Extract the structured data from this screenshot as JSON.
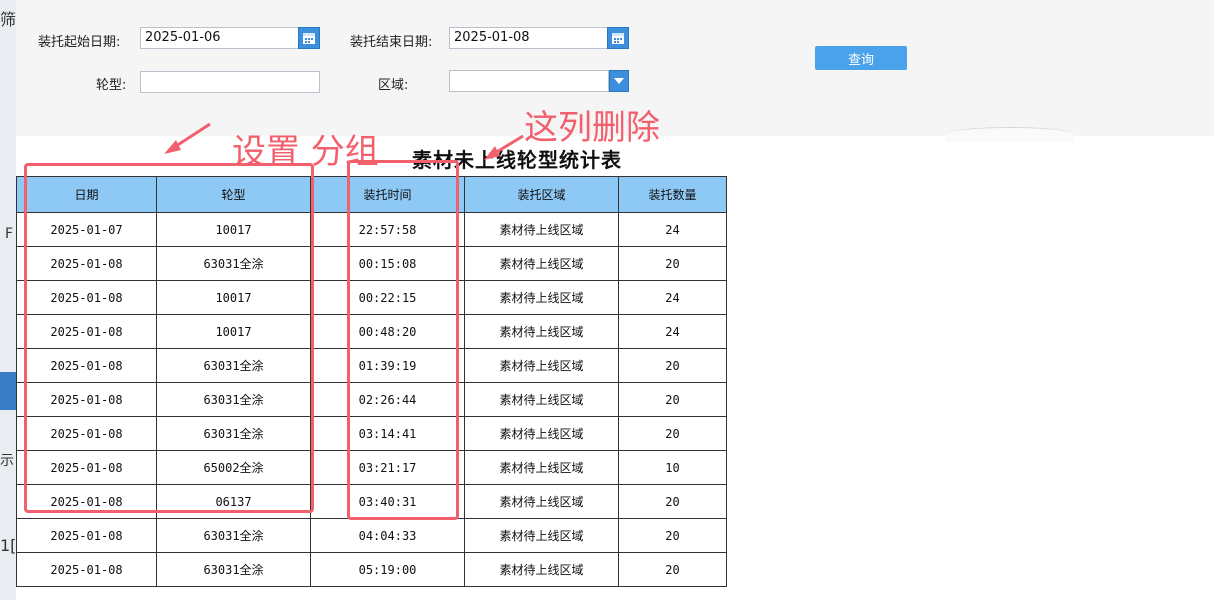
{
  "left_edge": {
    "fragments": [
      "筛",
      "F",
      "示",
      "1[",
      "日"
    ]
  },
  "filter": {
    "start_label": "装托起始日期:",
    "start_value": "2025-01-06",
    "end_label": "装托结束日期:",
    "end_value": "2025-01-08",
    "tire_label": "轮型:",
    "tire_value": "",
    "area_label": "区域:",
    "area_value": "",
    "query_label": "查询"
  },
  "report": {
    "title": "素材未上线轮型统计表",
    "columns": [
      "日期",
      "轮型",
      "装托时间",
      "装托区域",
      "装托数量"
    ],
    "rows": [
      [
        "2025-01-07",
        "10017",
        "22:57:58",
        "素材待上线区域",
        "24"
      ],
      [
        "2025-01-08",
        "63031全涂",
        "00:15:08",
        "素材待上线区域",
        "20"
      ],
      [
        "2025-01-08",
        "10017",
        "00:22:15",
        "素材待上线区域",
        "24"
      ],
      [
        "2025-01-08",
        "10017",
        "00:48:20",
        "素材待上线区域",
        "24"
      ],
      [
        "2025-01-08",
        "63031全涂",
        "01:39:19",
        "素材待上线区域",
        "20"
      ],
      [
        "2025-01-08",
        "63031全涂",
        "02:26:44",
        "素材待上线区域",
        "20"
      ],
      [
        "2025-01-08",
        "63031全涂",
        "03:14:41",
        "素材待上线区域",
        "20"
      ],
      [
        "2025-01-08",
        "65002全涂",
        "03:21:17",
        "素材待上线区域",
        "10"
      ],
      [
        "2025-01-08",
        "06137",
        "03:40:31",
        "素材待上线区域",
        "20"
      ],
      [
        "2025-01-08",
        "63031全涂",
        "04:04:33",
        "素材待上线区域",
        "20"
      ],
      [
        "2025-01-08",
        "63031全涂",
        "05:19:00",
        "素材待上线区域",
        "20"
      ]
    ]
  },
  "annotations": {
    "group_note": "设置 分组",
    "delete_note": "这列删除",
    "color": "#f2606e"
  }
}
